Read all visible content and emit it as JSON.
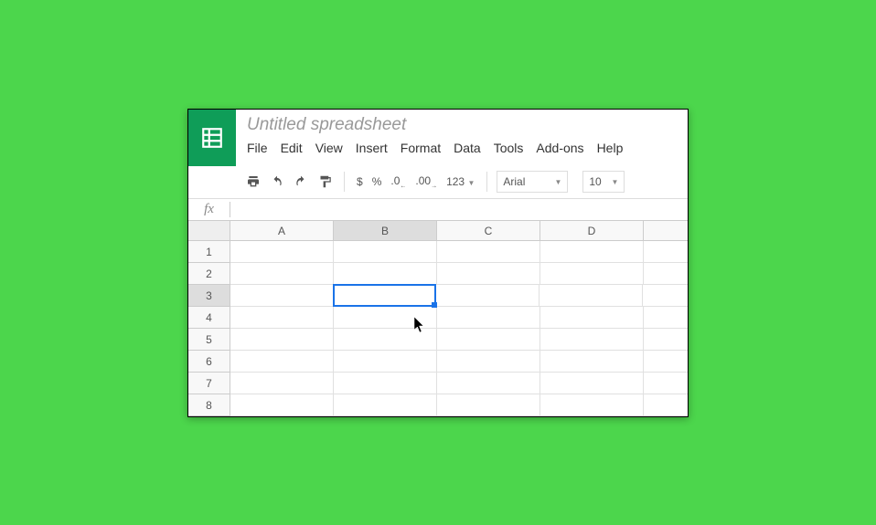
{
  "title": "Untitled spreadsheet",
  "menu": {
    "file": "File",
    "edit": "Edit",
    "view": "View",
    "insert": "Insert",
    "format": "Format",
    "data": "Data",
    "tools": "Tools",
    "addons": "Add-ons",
    "help": "Help"
  },
  "toolbar": {
    "currency": "$",
    "percent": "%",
    "dec_dec": ".0",
    "inc_dec": ".00",
    "numfmt": "123",
    "font": "Arial",
    "size": "10"
  },
  "fx": {
    "label": "fx",
    "value": ""
  },
  "cols": [
    "A",
    "B",
    "C",
    "D"
  ],
  "rows": [
    "1",
    "2",
    "3",
    "4",
    "5",
    "6",
    "7",
    "8"
  ],
  "selected": {
    "col": "B",
    "row": "3"
  }
}
